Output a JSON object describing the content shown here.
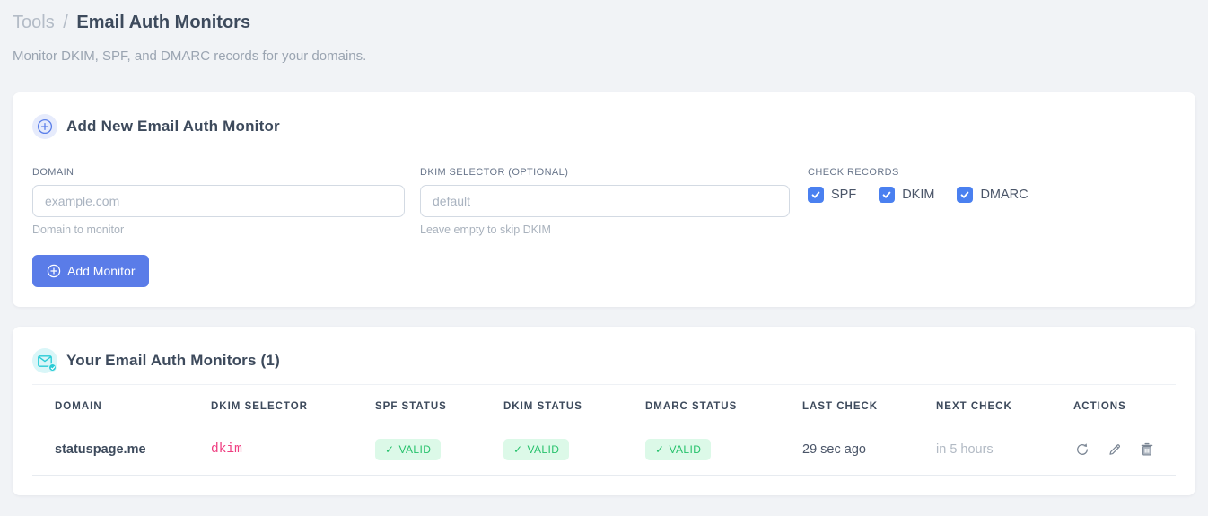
{
  "page": {
    "breadcrumb_root": "Tools",
    "breadcrumb_separator": "/",
    "title": "Email Auth Monitors",
    "subtitle": "Monitor DKIM, SPF, and DMARC records for your domains."
  },
  "add_form": {
    "title": "Add New Email Auth Monitor",
    "domain_field": {
      "label": "DOMAIN",
      "value": "",
      "placeholder": "example.com",
      "hint": "Domain to monitor"
    },
    "dkim_field": {
      "label": "DKIM SELECTOR (OPTIONAL)",
      "value": "",
      "placeholder": "default",
      "hint": "Leave empty to skip DKIM"
    },
    "check_records": {
      "label": "CHECK RECORDS",
      "options": [
        {
          "label": "SPF",
          "checked": true
        },
        {
          "label": "DKIM",
          "checked": true
        },
        {
          "label": "DMARC",
          "checked": true
        }
      ]
    },
    "submit_label": "Add Monitor"
  },
  "monitors": {
    "title": "Your Email Auth Monitors (1)",
    "count": 1,
    "columns": [
      "DOMAIN",
      "DKIM SELECTOR",
      "SPF STATUS",
      "DKIM STATUS",
      "DMARC STATUS",
      "LAST CHECK",
      "NEXT CHECK",
      "ACTIONS"
    ],
    "valid_glyph": "✓",
    "rows": [
      {
        "domain": "statuspage.me",
        "dkim_selector": "dkim",
        "spf_status": "VALID",
        "dkim_status": "VALID",
        "dmarc_status": "VALID",
        "last_check": "29 sec ago",
        "next_check": "in 5 hours"
      }
    ]
  },
  "icons": {
    "add_circle": "plus-in-circle",
    "monitors_bubble": "envelope-with-check",
    "row_actions": [
      "refresh-icon",
      "edit-pencil-icon",
      "trash-icon"
    ]
  },
  "colors": {
    "page_background": "#f1f3f6",
    "primary_blue": "#5a7ce8",
    "checkbox_blue": "#4a80f0",
    "bubble_lavender": "#e6ebfc",
    "cyan": "#29ccd6",
    "cyan_bubble": "#d9f6f8",
    "valid_green": "#27c26c",
    "valid_green_bg": "#dcf9e8",
    "code_pink": "#ef3d80",
    "text_dark": "#3d4a5c",
    "text_muted": "#9aa4b1"
  }
}
